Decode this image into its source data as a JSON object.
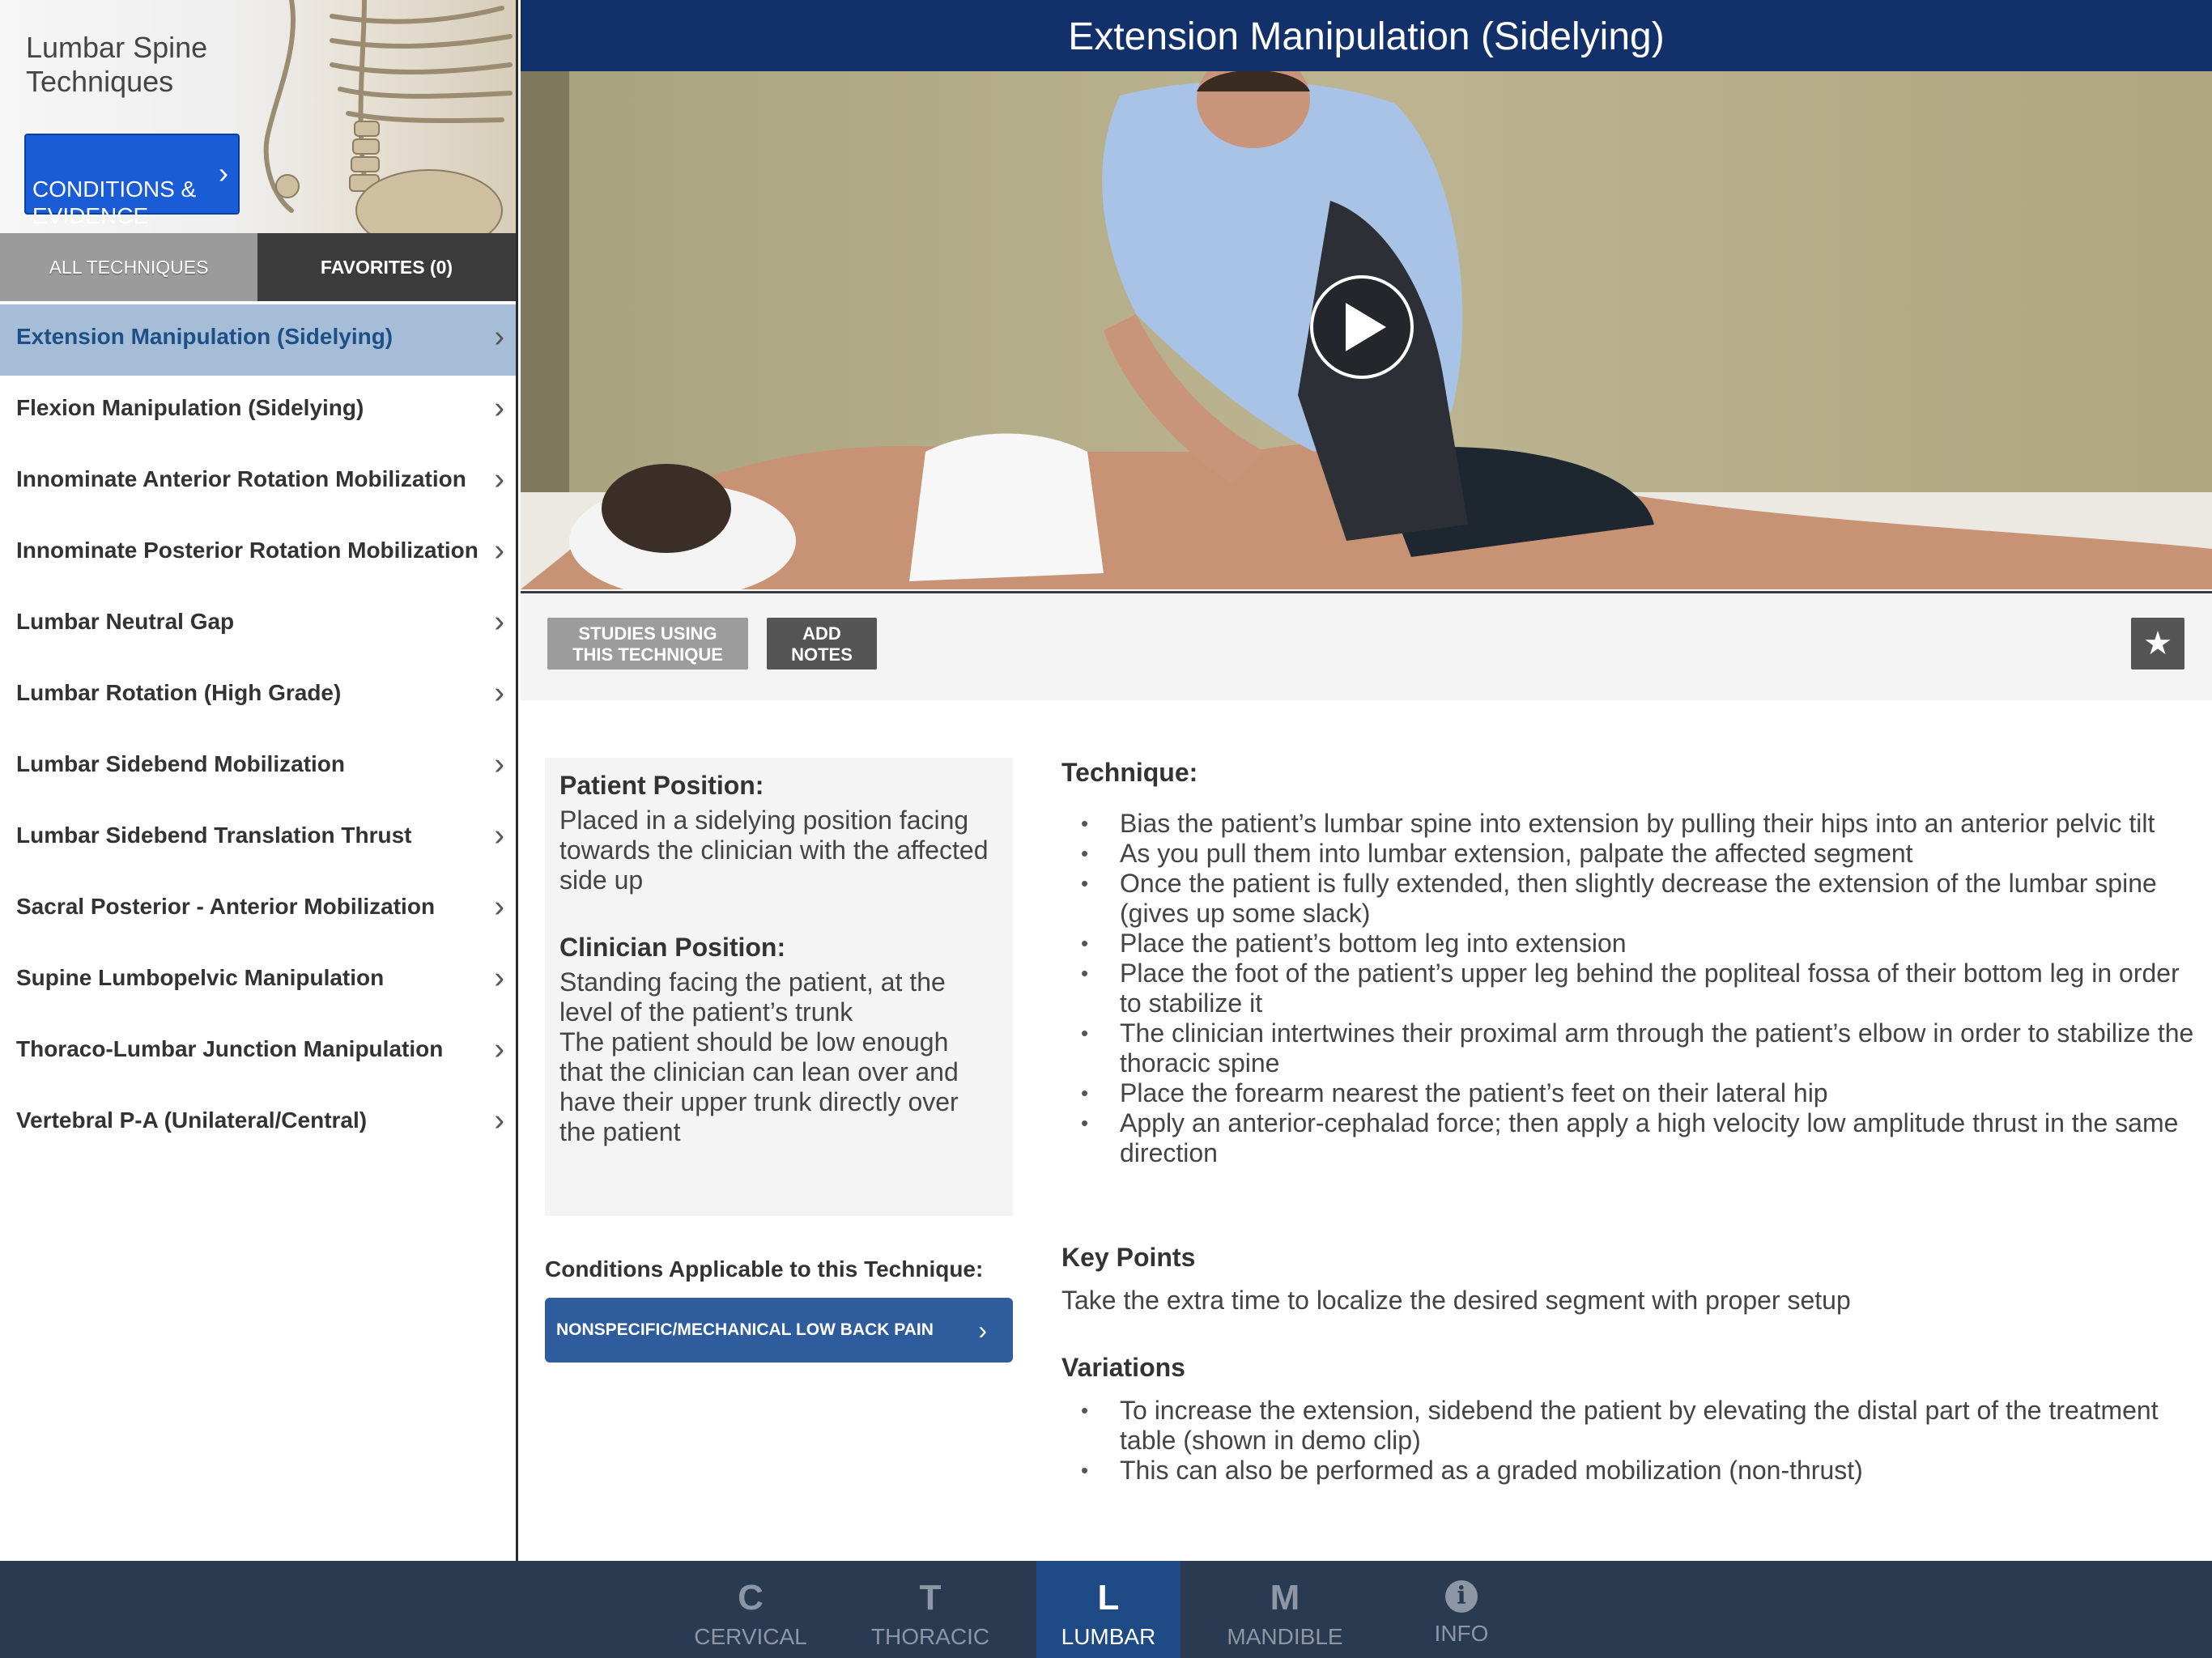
{
  "sidebar": {
    "app_title": "Lumbar Spine\nTechniques",
    "conditions_button": "CONDITIONS &\nEVIDENCE",
    "segments": {
      "all": "ALL TECHNIQUES",
      "favorites": "FAVORITES (0)"
    },
    "techniques": [
      "Extension Manipulation (Sidelying)",
      "Flexion Manipulation (Sidelying)",
      "Innominate Anterior Rotation Mobilization",
      "Innominate Posterior Rotation Mobilization",
      "Lumbar Neutral Gap",
      "Lumbar Rotation (High Grade)",
      "Lumbar Sidebend Mobilization",
      "Lumbar Sidebend Translation Thrust",
      "Sacral Posterior - Anterior Mobilization",
      "Supine Lumbopelvic Manipulation",
      "Thoraco-Lumbar Junction Manipulation",
      "Vertebral P-A (Unilateral/Central)"
    ],
    "selected_index": 0
  },
  "main": {
    "title": "Extension Manipulation (Sidelying)",
    "buttons": {
      "studies": "STUDIES USING\nTHIS TECHNIQUE",
      "notes": "ADD\nNOTES",
      "favorite_icon": "star-icon"
    },
    "patient_position": {
      "heading": "Patient Position:",
      "text": "Placed in a sidelying position facing towards the clinician with the affected side up"
    },
    "clinician_position": {
      "heading": "Clinician Position:",
      "lines": [
        "Standing facing the patient, at the level of the patient’s trunk",
        "The patient should be low enough that the clinician can lean over and have their upper trunk directly over the patient"
      ]
    },
    "conditions": {
      "label": "Conditions Applicable to this Technique:",
      "items": [
        "NONSPECIFIC/MECHANICAL LOW BACK PAIN"
      ]
    },
    "technique": {
      "heading": "Technique:",
      "steps": [
        "Bias the patient’s lumbar spine into extension by pulling their hips into an anterior pelvic tilt",
        "As you pull them into lumbar extension, palpate the affected segment",
        "Once the patient is fully extended, then slightly decrease the extension of the lumbar spine (gives up some slack)",
        "Place the patient’s bottom leg into extension",
        "Place the foot of the patient’s upper leg behind the popliteal fossa of their bottom leg in order to stabilize it",
        "The clinician intertwines their proximal arm through the patient’s elbow in order to stabilize the thoracic spine",
        "Place the forearm nearest the patient’s feet on their lateral hip",
        "Apply an anterior-cephalad force; then apply a high velocity low amplitude thrust in the same direction"
      ]
    },
    "key_points": {
      "heading": "Key Points",
      "text": "Take the extra time to localize the desired segment with proper setup"
    },
    "variations": {
      "heading": "Variations",
      "items": [
        "To increase the extension, sidebend the patient by elevating the distal part of the treatment table (shown in demo clip)",
        "This can also be performed as a graded mobilization (non-thrust)"
      ]
    }
  },
  "tabbar": {
    "tabs": [
      {
        "glyph": "C",
        "label": "CERVICAL"
      },
      {
        "glyph": "T",
        "label": "THORACIC"
      },
      {
        "glyph": "L",
        "label": "LUMBAR"
      },
      {
        "glyph": "M",
        "label": "MANDIBLE"
      },
      {
        "glyph": "i",
        "label": "INFO",
        "icon": "info-icon"
      }
    ],
    "active": "LUMBAR"
  },
  "colors": {
    "title_bar": "#12306a",
    "accent_blue": "#1a5bd6",
    "selected_row": "#a5bdd6",
    "tabbar": "#2a3a50",
    "tab_active": "#1e4a86"
  }
}
